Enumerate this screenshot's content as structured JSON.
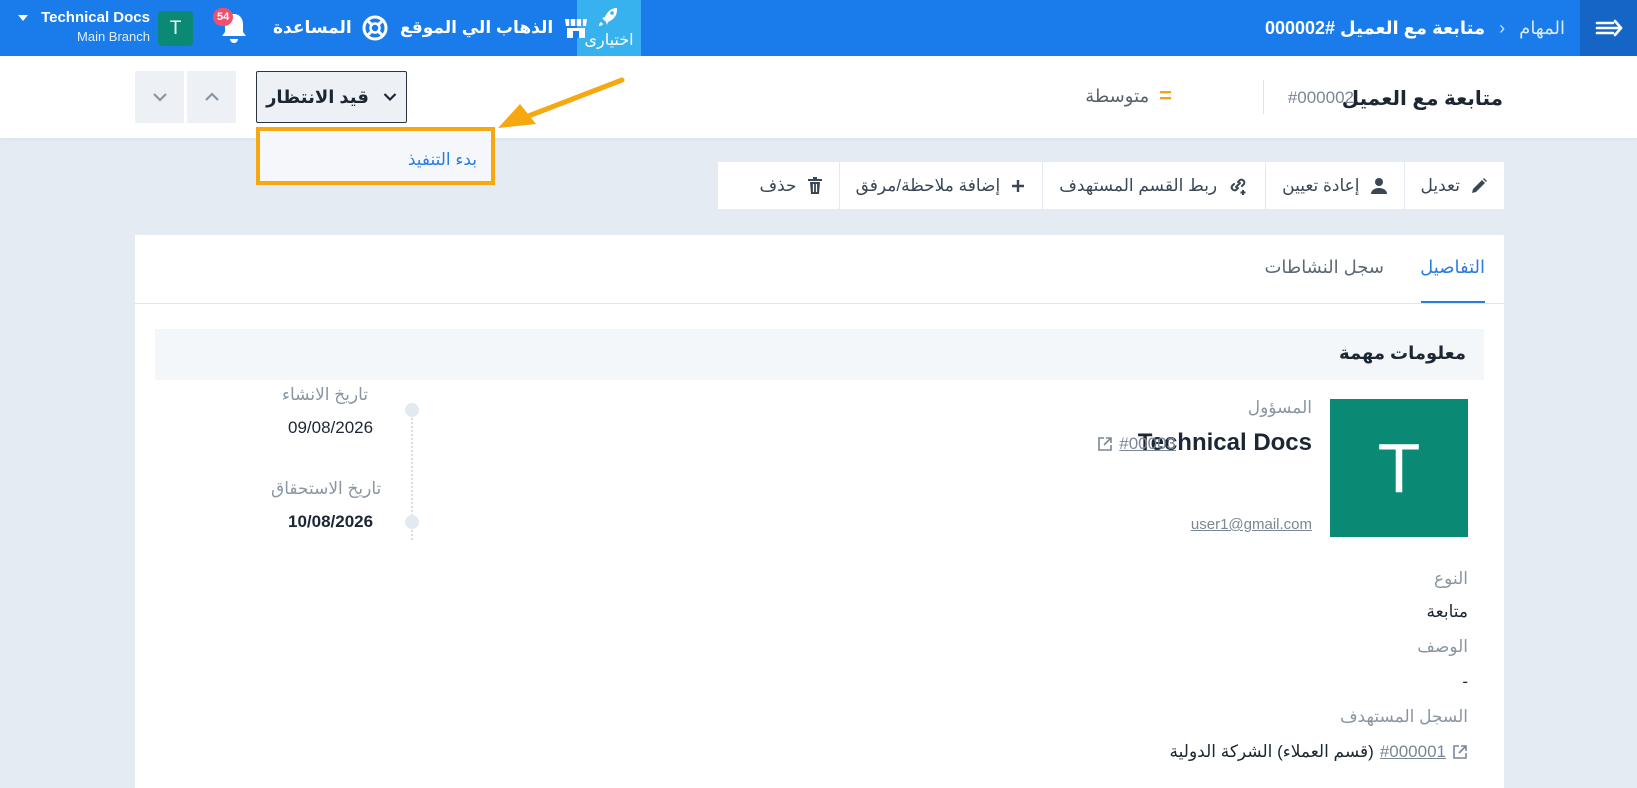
{
  "topbar": {
    "breadcrumb_parent": "المهام",
    "breadcrumb_sep": "›",
    "breadcrumb_current": "متابعة مع العميل #000002",
    "ikhtiyari_label": "اختيارى",
    "go_to_site_label": "الذهاب الي الموقع",
    "help_label": "المساعدة",
    "notifications_count": "54",
    "user_initial": "T",
    "account_name": "Technical Docs",
    "account_branch": "Main Branch"
  },
  "header": {
    "task_title": "متابعة مع العميل",
    "task_number": "#000002",
    "priority_symbol": "=",
    "priority_label": "متوسطة",
    "status_label": "قيد الانتظار",
    "dropdown_item": "بدء التنفيذ"
  },
  "toolbar": {
    "edit": "تعديل",
    "reassign": "إعادة تعيين",
    "link_department": "ربط القسم المستهدف",
    "add_note": "إضافة ملاحظة/مرفق",
    "delete": "حذف"
  },
  "tabs": {
    "details": "التفاصيل",
    "activity_log": "سجل النشاطات"
  },
  "details": {
    "section_title": "معلومات مهمة",
    "avatar_initial": "T",
    "assignee_label": "المسؤول",
    "assignee_name": "Technical Docs",
    "assignee_id": "#00003",
    "assignee_email": "user1@gmail.com",
    "created_label": "تاريخ الانشاء",
    "created_value": "09/08/2026",
    "due_label": "تاريخ الاستحقاق",
    "due_value": "10/08/2026",
    "type_label": "النوع",
    "type_value": "متابعة",
    "description_label": "الوصف",
    "description_value": "-",
    "target_record_label": "السجل المستهدف",
    "target_record_prefix": "(قسم العملاء) الشركة الدولية",
    "target_record_id": "#000001"
  },
  "colors": {
    "topbar": "#1a7bea",
    "accent": "#2a7de0",
    "highlight": "#f5a80f",
    "avatar": "#0a8a74",
    "badge": "#f0506e"
  }
}
